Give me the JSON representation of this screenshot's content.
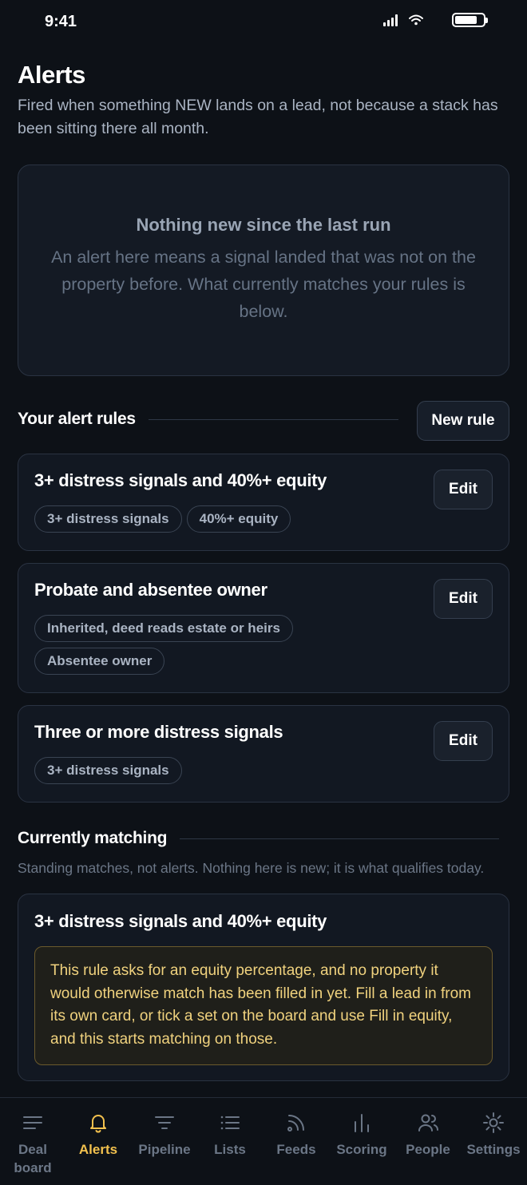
{
  "status_bar": {
    "time": "9:41"
  },
  "header": {
    "title": "Alerts",
    "subtitle": "Fired when something NEW lands on a lead, not because a stack has been sitting there all month."
  },
  "empty_state": {
    "title": "Nothing new since the last run",
    "body": "An alert here means a signal landed that was not on the property before. What currently matches your rules is below."
  },
  "rules_section": {
    "title": "Your alert rules",
    "new_rule_label": "New rule",
    "rules": [
      {
        "name": "3+ distress signals and 40%+ equity",
        "edit_label": "Edit",
        "chips": [
          "3+ distress signals",
          "40%+ equity"
        ]
      },
      {
        "name": "Probate and absentee owner",
        "edit_label": "Edit",
        "chips": [
          "Inherited, deed reads estate or heirs",
          "Absentee owner"
        ]
      },
      {
        "name": "Three or more distress signals",
        "edit_label": "Edit",
        "chips": [
          "3+ distress signals"
        ]
      }
    ]
  },
  "matching_section": {
    "title": "Currently matching",
    "subtitle": "Standing matches, not alerts. Nothing here is new; it is what qualifies today.",
    "card": {
      "title": "3+ distress signals and 40%+ equity",
      "warning": "This rule asks for an equity percentage, and no property it would otherwise match has been filled in yet. Fill a lead in from its own card, or tick a set on the board and use Fill in equity, and this starts matching on those."
    }
  },
  "tab_bar": {
    "active_color": "#f2c14e",
    "tabs": [
      {
        "label": "Deal board",
        "icon": "menu-lines-icon",
        "active": false
      },
      {
        "label": "Alerts",
        "icon": "bell-icon",
        "active": true
      },
      {
        "label": "Pipeline",
        "icon": "filter-icon",
        "active": false
      },
      {
        "label": "Lists",
        "icon": "list-icon",
        "active": false
      },
      {
        "label": "Feeds",
        "icon": "rss-icon",
        "active": false
      },
      {
        "label": "Scoring",
        "icon": "bar-chart-icon",
        "active": false
      },
      {
        "label": "People",
        "icon": "people-icon",
        "active": false
      },
      {
        "label": "Settings",
        "icon": "sun-gear-icon",
        "active": false
      }
    ]
  }
}
